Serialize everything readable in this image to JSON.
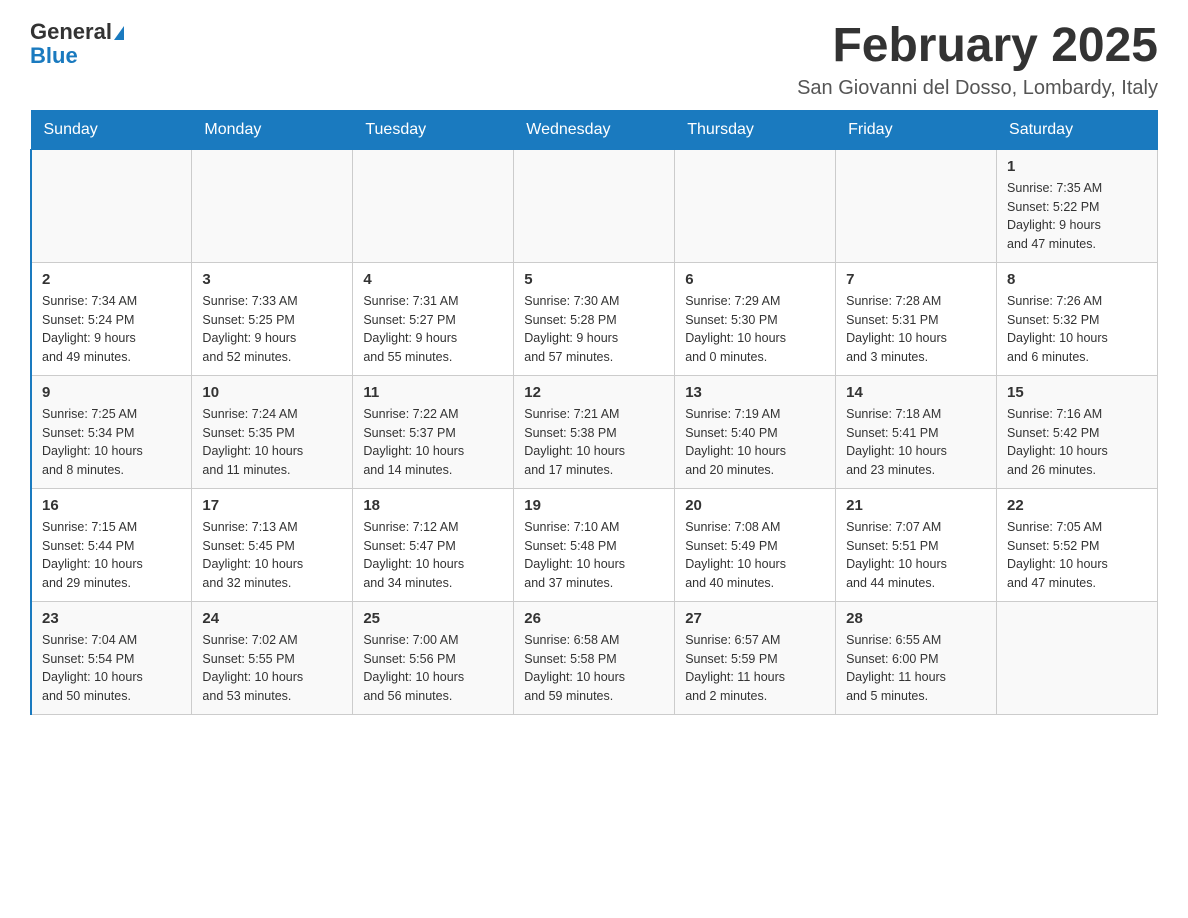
{
  "header": {
    "logo_line1": "General",
    "logo_line2": "Blue",
    "title": "February 2025",
    "subtitle": "San Giovanni del Dosso, Lombardy, Italy"
  },
  "weekdays": [
    "Sunday",
    "Monday",
    "Tuesday",
    "Wednesday",
    "Thursday",
    "Friday",
    "Saturday"
  ],
  "weeks": [
    [
      {
        "day": "",
        "info": ""
      },
      {
        "day": "",
        "info": ""
      },
      {
        "day": "",
        "info": ""
      },
      {
        "day": "",
        "info": ""
      },
      {
        "day": "",
        "info": ""
      },
      {
        "day": "",
        "info": ""
      },
      {
        "day": "1",
        "info": "Sunrise: 7:35 AM\nSunset: 5:22 PM\nDaylight: 9 hours\nand 47 minutes."
      }
    ],
    [
      {
        "day": "2",
        "info": "Sunrise: 7:34 AM\nSunset: 5:24 PM\nDaylight: 9 hours\nand 49 minutes."
      },
      {
        "day": "3",
        "info": "Sunrise: 7:33 AM\nSunset: 5:25 PM\nDaylight: 9 hours\nand 52 minutes."
      },
      {
        "day": "4",
        "info": "Sunrise: 7:31 AM\nSunset: 5:27 PM\nDaylight: 9 hours\nand 55 minutes."
      },
      {
        "day": "5",
        "info": "Sunrise: 7:30 AM\nSunset: 5:28 PM\nDaylight: 9 hours\nand 57 minutes."
      },
      {
        "day": "6",
        "info": "Sunrise: 7:29 AM\nSunset: 5:30 PM\nDaylight: 10 hours\nand 0 minutes."
      },
      {
        "day": "7",
        "info": "Sunrise: 7:28 AM\nSunset: 5:31 PM\nDaylight: 10 hours\nand 3 minutes."
      },
      {
        "day": "8",
        "info": "Sunrise: 7:26 AM\nSunset: 5:32 PM\nDaylight: 10 hours\nand 6 minutes."
      }
    ],
    [
      {
        "day": "9",
        "info": "Sunrise: 7:25 AM\nSunset: 5:34 PM\nDaylight: 10 hours\nand 8 minutes."
      },
      {
        "day": "10",
        "info": "Sunrise: 7:24 AM\nSunset: 5:35 PM\nDaylight: 10 hours\nand 11 minutes."
      },
      {
        "day": "11",
        "info": "Sunrise: 7:22 AM\nSunset: 5:37 PM\nDaylight: 10 hours\nand 14 minutes."
      },
      {
        "day": "12",
        "info": "Sunrise: 7:21 AM\nSunset: 5:38 PM\nDaylight: 10 hours\nand 17 minutes."
      },
      {
        "day": "13",
        "info": "Sunrise: 7:19 AM\nSunset: 5:40 PM\nDaylight: 10 hours\nand 20 minutes."
      },
      {
        "day": "14",
        "info": "Sunrise: 7:18 AM\nSunset: 5:41 PM\nDaylight: 10 hours\nand 23 minutes."
      },
      {
        "day": "15",
        "info": "Sunrise: 7:16 AM\nSunset: 5:42 PM\nDaylight: 10 hours\nand 26 minutes."
      }
    ],
    [
      {
        "day": "16",
        "info": "Sunrise: 7:15 AM\nSunset: 5:44 PM\nDaylight: 10 hours\nand 29 minutes."
      },
      {
        "day": "17",
        "info": "Sunrise: 7:13 AM\nSunset: 5:45 PM\nDaylight: 10 hours\nand 32 minutes."
      },
      {
        "day": "18",
        "info": "Sunrise: 7:12 AM\nSunset: 5:47 PM\nDaylight: 10 hours\nand 34 minutes."
      },
      {
        "day": "19",
        "info": "Sunrise: 7:10 AM\nSunset: 5:48 PM\nDaylight: 10 hours\nand 37 minutes."
      },
      {
        "day": "20",
        "info": "Sunrise: 7:08 AM\nSunset: 5:49 PM\nDaylight: 10 hours\nand 40 minutes."
      },
      {
        "day": "21",
        "info": "Sunrise: 7:07 AM\nSunset: 5:51 PM\nDaylight: 10 hours\nand 44 minutes."
      },
      {
        "day": "22",
        "info": "Sunrise: 7:05 AM\nSunset: 5:52 PM\nDaylight: 10 hours\nand 47 minutes."
      }
    ],
    [
      {
        "day": "23",
        "info": "Sunrise: 7:04 AM\nSunset: 5:54 PM\nDaylight: 10 hours\nand 50 minutes."
      },
      {
        "day": "24",
        "info": "Sunrise: 7:02 AM\nSunset: 5:55 PM\nDaylight: 10 hours\nand 53 minutes."
      },
      {
        "day": "25",
        "info": "Sunrise: 7:00 AM\nSunset: 5:56 PM\nDaylight: 10 hours\nand 56 minutes."
      },
      {
        "day": "26",
        "info": "Sunrise: 6:58 AM\nSunset: 5:58 PM\nDaylight: 10 hours\nand 59 minutes."
      },
      {
        "day": "27",
        "info": "Sunrise: 6:57 AM\nSunset: 5:59 PM\nDaylight: 11 hours\nand 2 minutes."
      },
      {
        "day": "28",
        "info": "Sunrise: 6:55 AM\nSunset: 6:00 PM\nDaylight: 11 hours\nand 5 minutes."
      },
      {
        "day": "",
        "info": ""
      }
    ]
  ]
}
